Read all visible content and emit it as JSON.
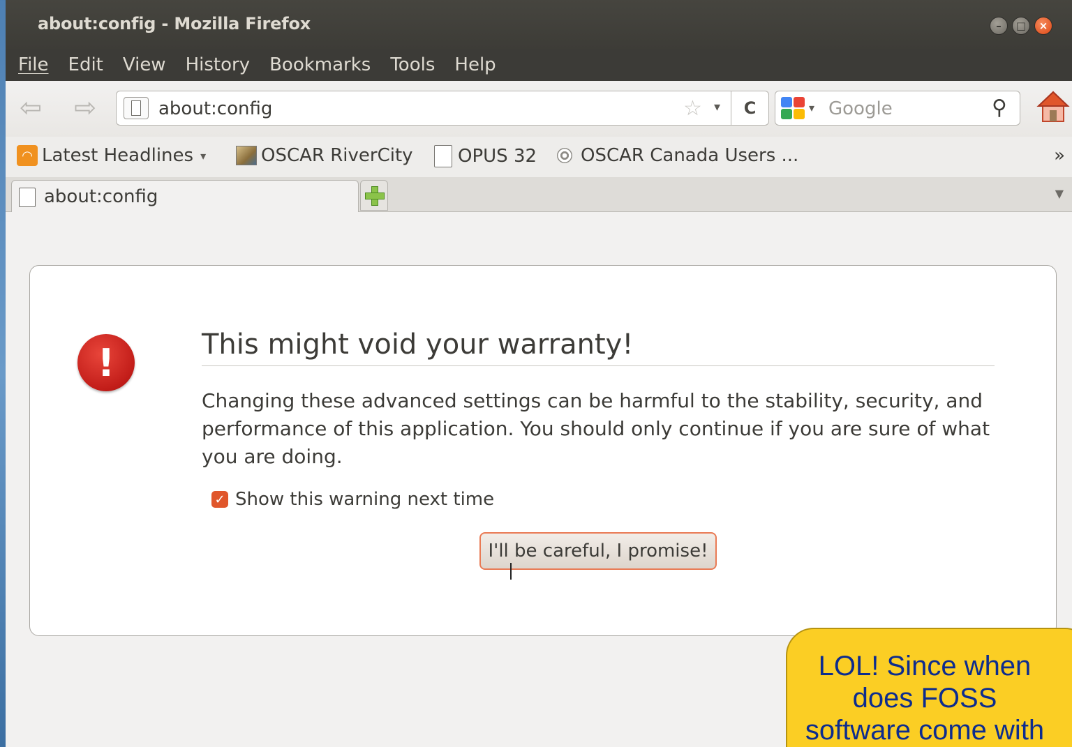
{
  "window": {
    "title": "about:config - Mozilla Firefox"
  },
  "menubar": {
    "items": [
      "File",
      "Edit",
      "View",
      "History",
      "Bookmarks",
      "Tools",
      "Help"
    ]
  },
  "navbar": {
    "url": "about:config",
    "search_placeholder": "Google"
  },
  "bookmarks": {
    "items": [
      "Latest Headlines",
      "OSCAR RiverCity",
      "OPUS 32",
      "OSCAR Canada Users ..."
    ],
    "overflow": "»"
  },
  "tabs": {
    "active_label": "about:config"
  },
  "warning": {
    "title": "This might void your warranty!",
    "message": "Changing these advanced settings can be harmful to the stability, security, and performance of this application. You should only continue if you are sure of what you are doing.",
    "checkbox_label": "Show this warning next time",
    "checkbox_checked": true,
    "button_label": "I'll be careful, I promise!"
  },
  "callout": {
    "text": "LOL! Since when does FOSS software come with a warranty?"
  },
  "colors": {
    "title_bar": "#3c3b37",
    "accent": "#e97a54",
    "callout_bg": "#fbce24",
    "callout_text": "#0d2c8e",
    "warning_icon": "#c21d19"
  }
}
